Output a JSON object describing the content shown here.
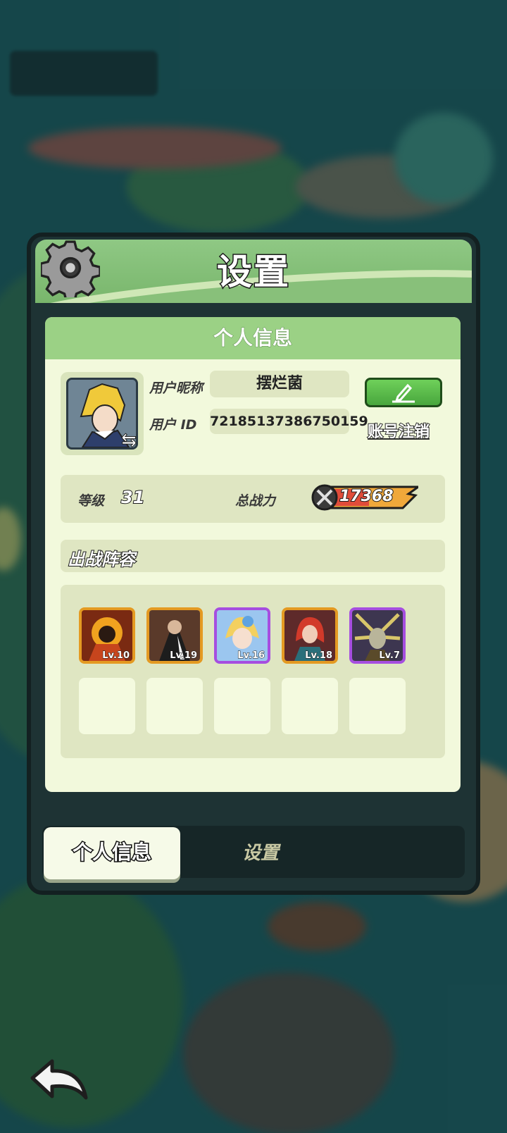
{
  "panel": {
    "title": "设置",
    "section_title": "个人信息"
  },
  "profile": {
    "nickname_label": "用户昵称",
    "nickname": "摆烂菌",
    "id_label": "用户 ID",
    "user_id": "72185137386750159",
    "cancel_account": "账号注销"
  },
  "stats": {
    "level_label": "等级",
    "level": "31",
    "power_label": "总战力",
    "power": "17368"
  },
  "lineup": {
    "title": "出战阵容",
    "heroes": [
      {
        "level": "Lv.10",
        "rarity": "gold",
        "color": "#c7451d"
      },
      {
        "level": "Lv.19",
        "rarity": "gold",
        "color": "#5a3a2a"
      },
      {
        "level": "Lv.16",
        "rarity": "purple",
        "color": "#7fb0e6"
      },
      {
        "level": "Lv.18",
        "rarity": "gold",
        "color": "#5e2a2a"
      },
      {
        "level": "Lv.7",
        "rarity": "purple",
        "color": "#3d3650"
      }
    ]
  },
  "tabs": {
    "active": "个人信息",
    "other": "设置"
  },
  "icons": [
    "gear-icon",
    "edit-pencil-icon",
    "swap-avatar-icon",
    "crossed-swords-icon",
    "back-arrow-icon"
  ],
  "colors": {
    "header_green": "#79b66c",
    "card_bg": "#f2f9dc",
    "edit_green": "#48a63d",
    "gold_frame": "#e49a22",
    "purple_frame": "#a64ee0"
  }
}
